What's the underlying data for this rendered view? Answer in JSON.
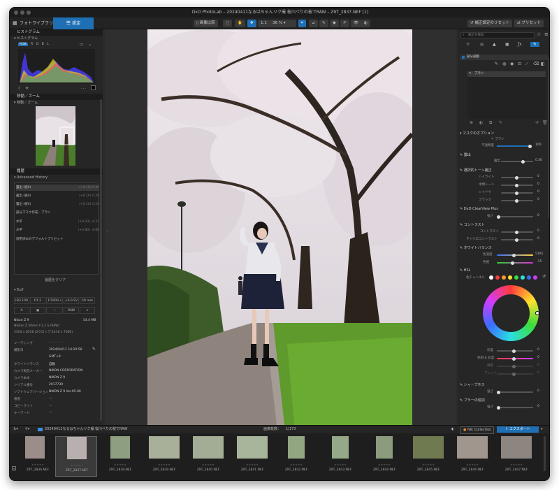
{
  "window": {
    "title": "DxO PhotoLab – 20240411なるはちゃんリク撮 桜川べりの桜でRAW – Z9T_2837.NEF [1]"
  },
  "toolbar": {
    "tab_library": "フォトライブラリ",
    "tab_customize": "設定",
    "compare": "画像比較",
    "zoom_11": "1:1",
    "zoom": "36 %",
    "reset_corrections": "補正設定のリセット",
    "presets": "プリセット"
  },
  "left": {
    "histogram_header": "ヒストグラム",
    "histogram_title": "ヒストグラム",
    "channels": [
      "RGB",
      "R",
      "G",
      "B",
      "L"
    ],
    "clip_values": "- - -",
    "navigator_header": "移動／ズーム",
    "navigator_title": "移動／ズーム",
    "history_header": "履歴",
    "history_title": "Advanced History",
    "history": [
      {
        "label": "露出 (値0)",
        "value": "(+0.10) 0.30"
      },
      {
        "label": "露出 (値0)",
        "value": "(+0.10) 0.20"
      },
      {
        "label": "露出 (値0)",
        "value": "(+0.10) 0.10"
      },
      {
        "label": "部分マスク作成 - ブラシ",
        "value": ""
      },
      {
        "label": "水平",
        "value": "(+0.43) -4.37"
      },
      {
        "label": "水平",
        "value": "(+4.80) -4.80"
      },
      {
        "label": "適用済みのデフォルトプリセット",
        "value": ""
      }
    ],
    "history_clear": "履歴をクリア",
    "exif_title": "Exif",
    "exif_cells": [
      "ISO 100",
      "f/1.2",
      "1/5000 s",
      "+0.0 EV",
      "50 mm"
    ],
    "exif_cells2": [
      "A",
      "",
      "---",
      "RAW",
      ""
    ],
    "camera": "Nikon Z 9",
    "file_size": "54.4 MB",
    "lens": "Nikkor Z 50mm F1.2 S (RAW)",
    "dimensions": "5504 x 8256 (2クロップ 4416 x 7080)",
    "meta": [
      {
        "label": "レーティング",
        "value": "☆☆☆☆☆"
      },
      {
        "label": "撮影日",
        "value": "2024/04/11 14:20:58"
      },
      {
        "label": "",
        "value": "GMT+9"
      },
      {
        "label": "ホワイトバランス",
        "value": "自動"
      },
      {
        "label": "カメラ製造メーカー",
        "value": "NIKON CORPORATION"
      },
      {
        "label": "カメラ本体",
        "value": "NIKON Z 9"
      },
      {
        "label": "シリアル番号",
        "value": "2017739"
      },
      {
        "label": "ソフトウェアバージョン",
        "value": "NIKON Z 9 Ver.05.00"
      },
      {
        "label": "著者",
        "value": "---"
      },
      {
        "label": "コピーライト",
        "value": "---"
      },
      {
        "label": "キーワード",
        "value": "---"
      }
    ]
  },
  "right": {
    "search_placeholder": "補正を検索",
    "local_adjust": "部分調整",
    "brush": "ブラシ",
    "mask_options": "マスクのオプション",
    "brush_sub": "ブラシ",
    "opacity_label": "不透明度",
    "opacity_value": "100",
    "exposure_section": "露出",
    "exposure_label": "露出",
    "exposure_value": "0.30",
    "tone_section": "選択的トーン補正",
    "tone": [
      {
        "label": "ハイライト",
        "value": "0"
      },
      {
        "label": "中間トーン",
        "value": "0"
      },
      {
        "label": "シャドウ",
        "value": "0"
      },
      {
        "label": "ブラック",
        "value": "0"
      }
    ],
    "clearview_section": "DxO ClearView Plus",
    "clearview_label": "強さ",
    "clearview_value": "0",
    "contrast_section": "コントラスト",
    "contrast": [
      {
        "label": "コントラスト",
        "value": "0"
      },
      {
        "label": "マイクロコントラスト",
        "value": "0"
      }
    ],
    "wb_section": "ホワイトバランス",
    "wb": [
      {
        "label": "色温度",
        "value": "5191"
      },
      {
        "label": "色相",
        "value": "-15"
      }
    ],
    "hsl_section": "HSL",
    "hsl_channel": "色チャンネル",
    "hsl_sliders": [
      {
        "label": "彩度",
        "value": "0"
      },
      {
        "label": "色相 & 彩度",
        "value": "0"
      },
      {
        "label": "輝度",
        "value": "0"
      },
      {
        "label": "ブレンド",
        "value": "0"
      }
    ],
    "sharp_section": "シャープネス",
    "sharp_label": "強さ",
    "sharp_value": "0",
    "blur_section": "ブラーの追加",
    "blur_label": "強さ",
    "blur_value": "0"
  },
  "filmstrip": {
    "folder": "20240411なるはちゃんリク撮 桜川べりの桜でRAW",
    "count_label": "画像枚数：",
    "count": "1/173",
    "nik": "Nik Collection",
    "export": "エクスポート",
    "thumbs": [
      "Z9T_2836.NEF",
      "Z9T_2837.NEF",
      "Z9T_2838.NEF",
      "Z9T_2839.NEF",
      "Z9T_2840.NEF",
      "Z9T_2841.NEF",
      "Z9T_2842.NEF",
      "Z9T_2843.NEF",
      "Z9T_2844.NEF",
      "Z9T_2845.NEF",
      "Z9T_2846.NEF",
      "Z9T_2847.NEF"
    ]
  },
  "colors": {
    "accent": "#1f6fb5",
    "panel": "#262626"
  }
}
